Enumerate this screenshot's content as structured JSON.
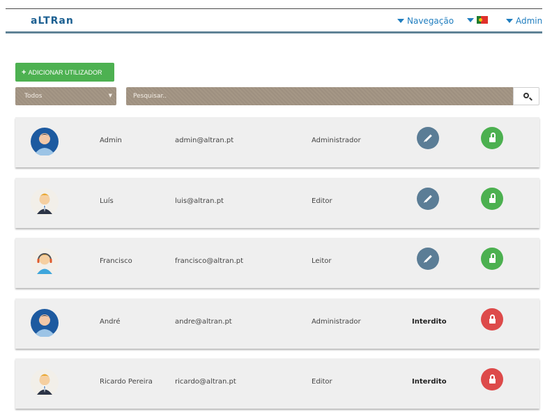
{
  "header": {
    "logo": "aLTRan",
    "nav_label": "Navegação",
    "user_label": "Admin"
  },
  "toolbar": {
    "add_label": "ADICIONAR UTILIZADOR",
    "filter_value": "Todos",
    "search_placeholder": "Pesquisar..",
    "search_icon": "search-icon"
  },
  "users": [
    {
      "name": "Admin",
      "email": "admin@altran.pt",
      "role": "Administrador",
      "status": "",
      "avatar": "blue-round",
      "lock": "unlocked"
    },
    {
      "name": "Luís",
      "email": "luis@altran.pt",
      "role": "Editor",
      "status": "",
      "avatar": "blond-suit",
      "lock": "unlocked"
    },
    {
      "name": "Francisco",
      "email": "francisco@altran.pt",
      "role": "Leitor",
      "status": "",
      "avatar": "headset",
      "lock": "unlocked"
    },
    {
      "name": "André",
      "email": "andre@altran.pt",
      "role": "Administrador",
      "status": "Interdito",
      "avatar": "blue-round",
      "lock": "locked"
    },
    {
      "name": "Ricardo Pereira",
      "email": "ricardo@altran.pt",
      "role": "Editor",
      "status": "Interdito",
      "avatar": "blond-suit",
      "lock": "locked"
    }
  ],
  "colors": {
    "accent": "#1f7dbf",
    "add_button": "#4db151",
    "edit": "#5b7d96",
    "unlocked": "#4cb050",
    "locked": "#dd4a4a"
  }
}
